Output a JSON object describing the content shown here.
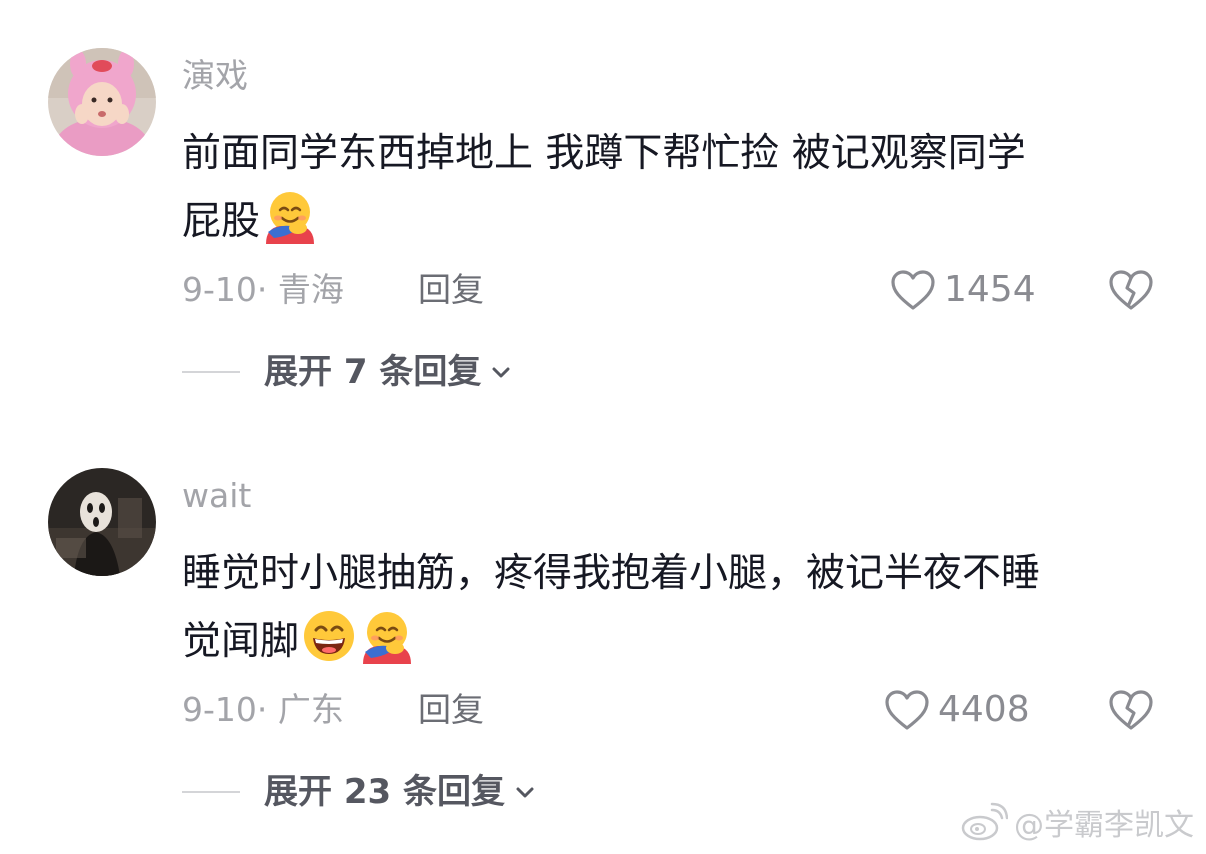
{
  "comments": [
    {
      "username": "演戏",
      "text_line1": "前面同学东西掉地上 我蹲下帮忙捡 被记观察同学",
      "text_line2": "屁股",
      "emojis": [
        "hug-face-emoji"
      ],
      "date": "9-10",
      "separator": "·",
      "location": "青海",
      "reply_label": "回复",
      "likes": "1454",
      "expand_label": "展开 7 条回复"
    },
    {
      "username": "wait",
      "text_line1": "睡觉时小腿抽筋，疼得我抱着小腿，被记半夜不睡",
      "text_line2": "觉闻脚",
      "emojis": [
        "grinning-face-emoji",
        "hug-face-emoji"
      ],
      "date": "9-10",
      "separator": "·",
      "location": "广东",
      "reply_label": "回复",
      "likes": "4408",
      "expand_label": "展开 23 条回复"
    }
  ],
  "watermark": {
    "text": "@学霸李凯文",
    "icon": "weibo-icon"
  },
  "colors": {
    "meta_gray": "#a3a4a9",
    "text_dark": "#161823",
    "reply_gray": "#6b6d74",
    "expand_gray": "#555760"
  }
}
